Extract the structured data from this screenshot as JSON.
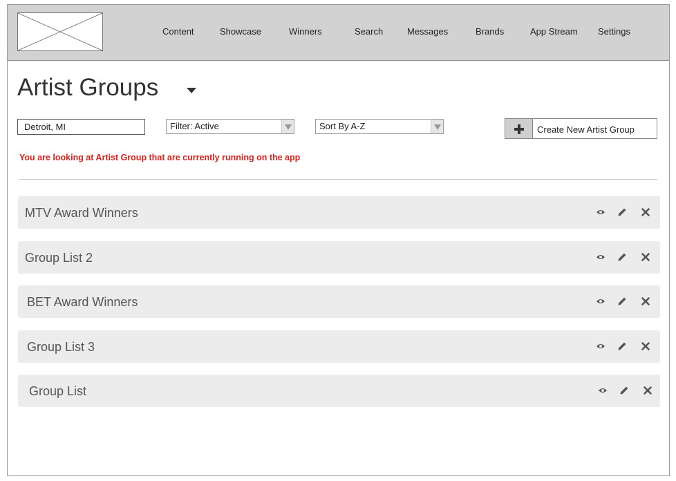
{
  "nav": {
    "items": [
      {
        "label": "Content"
      },
      {
        "label": "Showcase"
      },
      {
        "label": "Winners"
      },
      {
        "label": "Search"
      },
      {
        "label": "Messages"
      },
      {
        "label": "Brands"
      },
      {
        "label": "App Stream"
      },
      {
        "label": "Settings"
      }
    ]
  },
  "page": {
    "title": "Artist Groups"
  },
  "filters": {
    "location_value": "Detroit, MI",
    "status_filter": "Filter: Active",
    "sort": "Sort By A-Z"
  },
  "create_button": {
    "label": "Create New Artist Group",
    "icon": "plus-icon"
  },
  "info_message": "You are looking at Artist Group that are currently running on the app",
  "groups": [
    {
      "name": "MTV Award Winners"
    },
    {
      "name": "Group List 2"
    },
    {
      "name": "BET Award Winners"
    },
    {
      "name": "Group List 3"
    },
    {
      "name": "Group List"
    }
  ],
  "row_actions": [
    "eye-icon",
    "pencil-icon",
    "close-icon"
  ],
  "colors": {
    "header_bg": "#d2d2d2",
    "row_bg": "#ececec",
    "alert_text": "#e0201b"
  }
}
